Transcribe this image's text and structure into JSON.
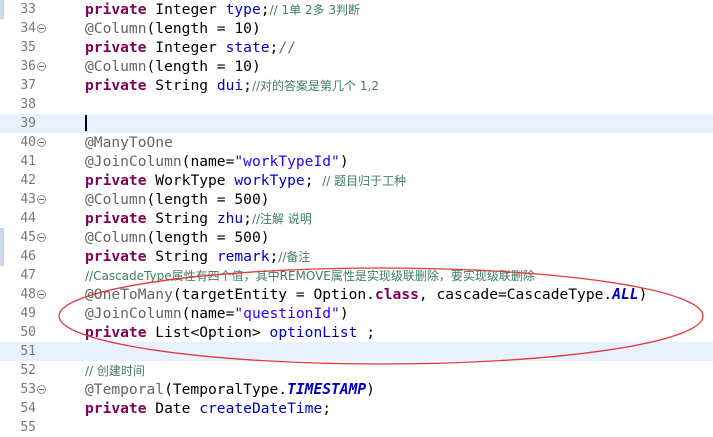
{
  "editor": {
    "lines": [
      {
        "num": "33",
        "fold": false,
        "tokens": [
          {
            "t": "private",
            "c": "kw"
          },
          {
            "t": " Integer "
          },
          {
            "t": "type",
            "c": "fld"
          },
          {
            "t": ";"
          },
          {
            "t": "// 1单 2多 3判断",
            "c": "cmt"
          }
        ]
      },
      {
        "num": "34",
        "fold": true,
        "tokens": [
          {
            "t": "@Column",
            "c": "ann"
          },
          {
            "t": "(length = 10)"
          }
        ]
      },
      {
        "num": "35",
        "fold": false,
        "tokens": [
          {
            "t": "private",
            "c": "kw"
          },
          {
            "t": " Integer "
          },
          {
            "t": "state",
            "c": "fld"
          },
          {
            "t": ";"
          },
          {
            "t": "//",
            "c": "cmt"
          }
        ]
      },
      {
        "num": "36",
        "fold": true,
        "tokens": [
          {
            "t": "@Column",
            "c": "ann"
          },
          {
            "t": "(length = 10)"
          }
        ]
      },
      {
        "num": "37",
        "fold": false,
        "tokens": [
          {
            "t": "private",
            "c": "kw"
          },
          {
            "t": " String "
          },
          {
            "t": "dui",
            "c": "fld"
          },
          {
            "t": ";"
          },
          {
            "t": "//对的答案是第几个 1,2",
            "c": "cmt"
          }
        ]
      },
      {
        "num": "38",
        "fold": false,
        "tokens": []
      },
      {
        "num": "39",
        "fold": false,
        "current": true,
        "caret": true,
        "tokens": []
      },
      {
        "num": "40",
        "fold": true,
        "tokens": [
          {
            "t": "@ManyToOne",
            "c": "ann"
          }
        ]
      },
      {
        "num": "41",
        "fold": false,
        "tokens": [
          {
            "t": "@JoinColumn",
            "c": "ann"
          },
          {
            "t": "(name="
          },
          {
            "t": "\"workTypeId\"",
            "c": "str"
          },
          {
            "t": ")"
          }
        ]
      },
      {
        "num": "42",
        "fold": false,
        "tokens": [
          {
            "t": "private",
            "c": "kw"
          },
          {
            "t": " WorkType "
          },
          {
            "t": "workType",
            "c": "fld"
          },
          {
            "t": "; "
          },
          {
            "t": "// 题目归于工种",
            "c": "cmt"
          }
        ]
      },
      {
        "num": "43",
        "fold": true,
        "tokens": [
          {
            "t": "@Column",
            "c": "ann"
          },
          {
            "t": "(length = 500)"
          }
        ]
      },
      {
        "num": "44",
        "fold": false,
        "tokens": [
          {
            "t": "private",
            "c": "kw"
          },
          {
            "t": " String "
          },
          {
            "t": "zhu",
            "c": "fld"
          },
          {
            "t": ";"
          },
          {
            "t": "//注解 说明",
            "c": "cmt"
          }
        ]
      },
      {
        "num": "45",
        "fold": true,
        "tokens": [
          {
            "t": "@Column",
            "c": "ann"
          },
          {
            "t": "(length = 500)"
          }
        ]
      },
      {
        "num": "46",
        "fold": false,
        "tokens": [
          {
            "t": "private",
            "c": "kw"
          },
          {
            "t": " String "
          },
          {
            "t": "remark",
            "c": "fld"
          },
          {
            "t": ";"
          },
          {
            "t": "//备注",
            "c": "cmt"
          }
        ]
      },
      {
        "num": "47",
        "fold": false,
        "tokens": [
          {
            "t": "//CascadeType属性有四个值，其中REMOVE属性是实现级联删除，要实现级联删除",
            "c": "cmt"
          }
        ]
      },
      {
        "num": "48",
        "fold": true,
        "tokens": [
          {
            "t": "@OneToMany",
            "c": "ann"
          },
          {
            "t": "(targetEntity = Option."
          },
          {
            "t": "class",
            "c": "kw"
          },
          {
            "t": ", cascade=CascadeType."
          },
          {
            "t": "ALL",
            "c": "const"
          },
          {
            "t": ")"
          }
        ]
      },
      {
        "num": "49",
        "fold": false,
        "tokens": [
          {
            "t": "@JoinColumn",
            "c": "ann"
          },
          {
            "t": "(name="
          },
          {
            "t": "\"questionId\"",
            "c": "str"
          },
          {
            "t": ")"
          }
        ]
      },
      {
        "num": "50",
        "fold": false,
        "tokens": [
          {
            "t": "private",
            "c": "kw"
          },
          {
            "t": " List<Option> "
          },
          {
            "t": "optionList",
            "c": "fld"
          },
          {
            "t": " ;"
          }
        ]
      },
      {
        "num": "51",
        "fold": false,
        "current": true,
        "tokens": []
      },
      {
        "num": "52",
        "fold": false,
        "tokens": [
          {
            "t": "// 创建时间",
            "c": "cmt"
          }
        ]
      },
      {
        "num": "53",
        "fold": true,
        "tokens": [
          {
            "t": "@Temporal",
            "c": "ann"
          },
          {
            "t": "(TemporalType."
          },
          {
            "t": "TIMESTAMP",
            "c": "const"
          },
          {
            "t": ")"
          }
        ]
      },
      {
        "num": "54",
        "fold": false,
        "tokens": [
          {
            "t": "private",
            "c": "kw"
          },
          {
            "t": " Date "
          },
          {
            "t": "createDateTime",
            "c": "fld"
          },
          {
            "t": ";"
          }
        ]
      },
      {
        "num": "55",
        "fold": false,
        "tokens": []
      }
    ]
  },
  "annotation": {
    "color": "#e0393e"
  },
  "colors": {
    "keyword": "#7f0055",
    "annotation": "#646464",
    "field": "#0000c0",
    "string": "#2a00ff",
    "comment": "#3f7f5f"
  }
}
